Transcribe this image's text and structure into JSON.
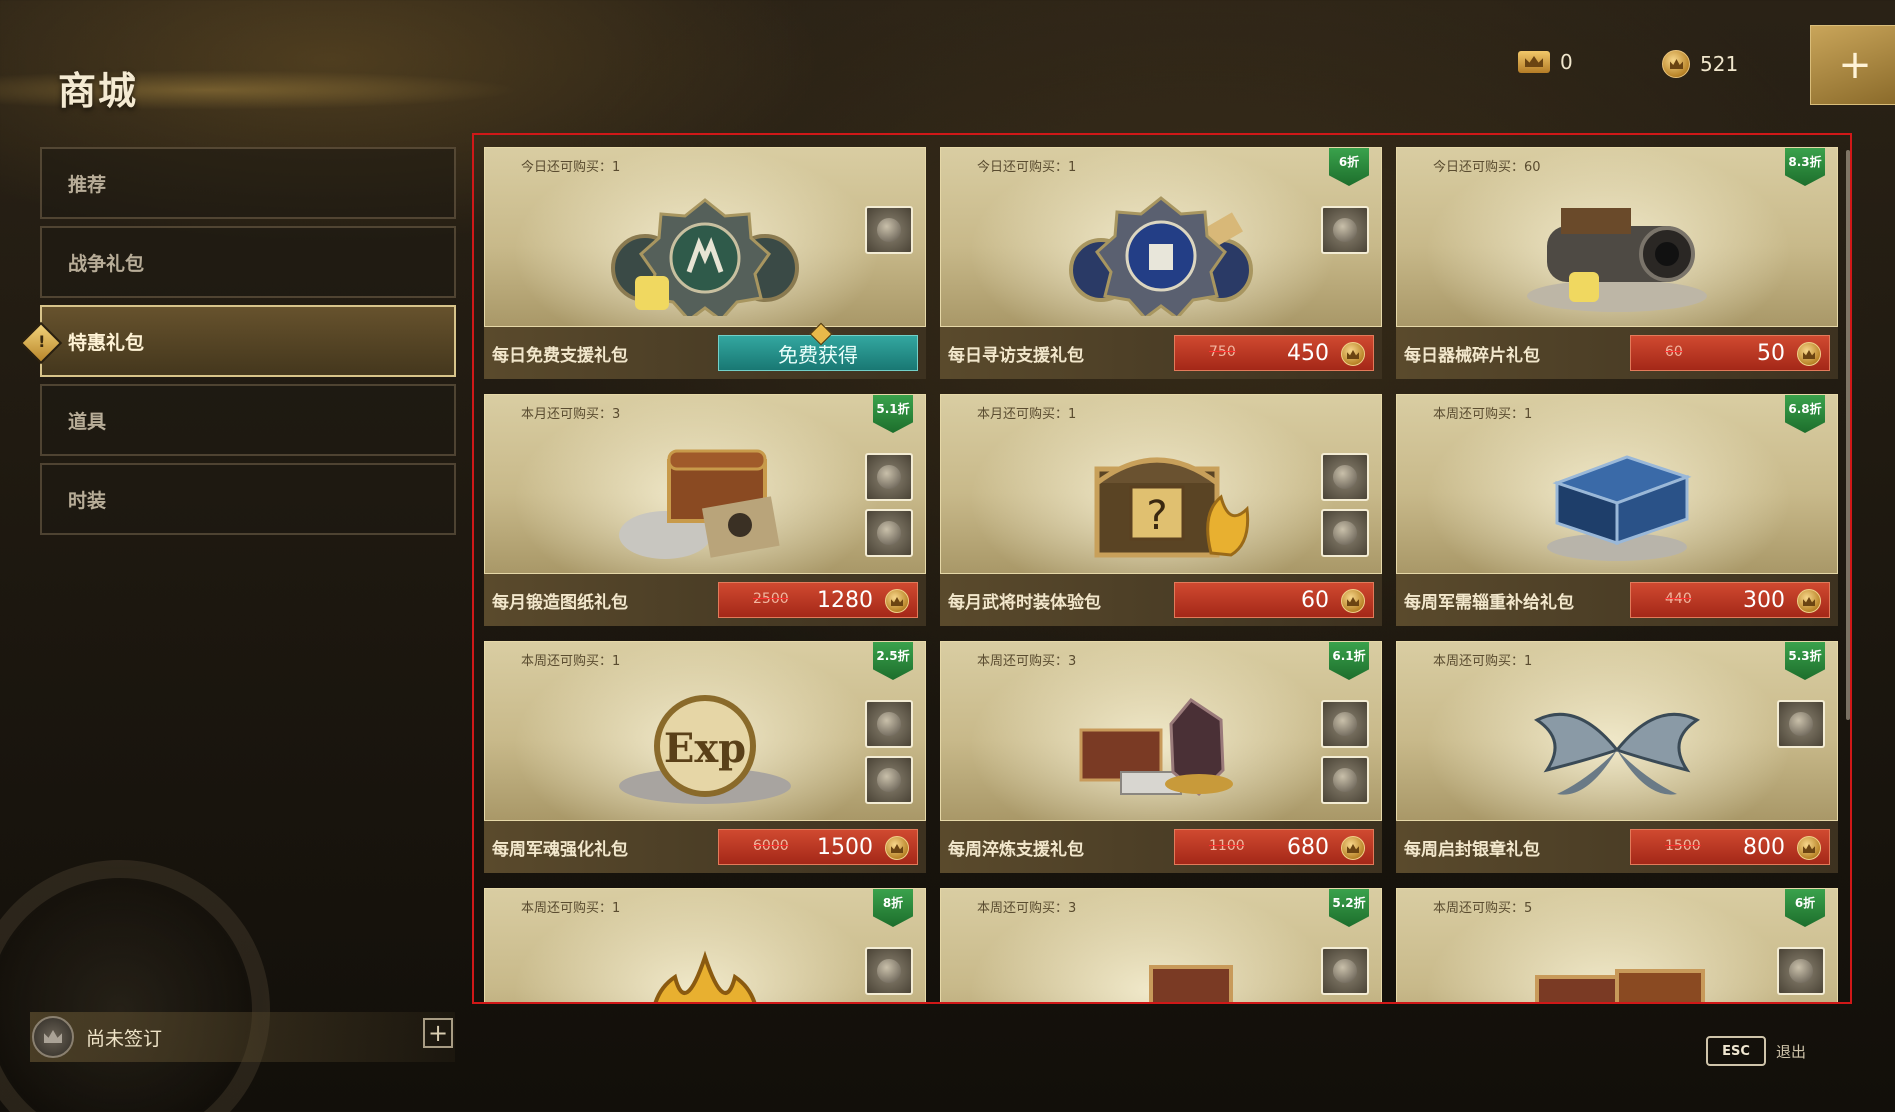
{
  "header": {
    "title": "商城",
    "currencies": [
      {
        "icon": "crown-gold-icon",
        "value": "0"
      },
      {
        "icon": "gold-coin-icon",
        "value": "521"
      }
    ],
    "add_label": "+"
  },
  "sidebar": {
    "items": [
      {
        "label": "推荐"
      },
      {
        "label": "战争礼包"
      },
      {
        "label": "特惠礼包",
        "active": true
      },
      {
        "label": "道具"
      },
      {
        "label": "时装"
      }
    ],
    "active_marker": "!"
  },
  "footer": {
    "sign_status": "尚未签订",
    "sign_add": "+",
    "esc_key": "ESC",
    "esc_label": "退出"
  },
  "colors": {
    "accent_gold": "#d8c48a",
    "price_red": "#c43a24",
    "free_teal": "#2a9590",
    "discount_green": "#2c8a3c",
    "highlight_frame": "#d01818"
  },
  "packs": [
    {
      "limit": "今日还可购买：1",
      "discount": "",
      "name": "每日免费支援礼包",
      "free_label": "免费获得",
      "price_old": "",
      "price_new": "",
      "hero": "emblem-green",
      "thumbs": [
        "emblem-thumb"
      ]
    },
    {
      "limit": "今日还可购买：1",
      "discount": "6折",
      "name": "每日寻访支援礼包",
      "price_old": "750",
      "price_new": "450",
      "hero": "emblem-blue",
      "thumbs": [
        "emblem-blue-thumb"
      ]
    },
    {
      "limit": "今日还可购买：60",
      "discount": "8.3折",
      "name": "每日器械碎片礼包",
      "price_old": "60",
      "price_new": "50",
      "hero": "cannon",
      "thumbs": []
    },
    {
      "limit": "本月还可购买：3",
      "discount": "5.1折",
      "name": "每月锻造图纸礼包",
      "price_old": "2500",
      "price_new": "1280",
      "hero": "chest-silver",
      "thumbs": [
        "chest-thumb",
        "ore-thumb"
      ]
    },
    {
      "limit": "本月还可购买：1",
      "discount": "",
      "name": "每月武将时装体验包",
      "price_old": "",
      "price_new": "60",
      "hero": "mystery-chest",
      "thumbs": [
        "mystery-thumb",
        "flame-thumb"
      ]
    },
    {
      "limit": "本周还可购买：1",
      "discount": "6.8折",
      "name": "每周军需辎重补给礼包",
      "price_old": "440",
      "price_new": "300",
      "hero": "blue-crate",
      "thumbs": []
    },
    {
      "limit": "本周还可购买：1",
      "discount": "2.5折",
      "name": "每周军魂强化礼包",
      "price_old": "6000",
      "price_new": "1500",
      "hero": "exp-badge",
      "thumbs": [
        "exp-thumb",
        "coins-chest-thumb"
      ]
    },
    {
      "limit": "本周还可购买：3",
      "discount": "6.1折",
      "name": "每周淬炼支援礼包",
      "price_old": "1100",
      "price_new": "680",
      "hero": "crystal-ingots",
      "thumbs": [
        "crystal-thumb",
        "chest-thumb"
      ]
    },
    {
      "limit": "本周还可购买：1",
      "discount": "5.3折",
      "name": "每周启封银章礼包",
      "price_old": "1500",
      "price_new": "800",
      "hero": "silver-wings",
      "thumbs": [
        "wings-thumb"
      ]
    },
    {
      "limit": "本周还可购买：1",
      "discount": "8折",
      "name": "",
      "price_old": "",
      "price_new": "",
      "hero": "gold-flame",
      "thumbs": [
        "flame-thumb"
      ]
    },
    {
      "limit": "本周还可购买：3",
      "discount": "5.2折",
      "name": "",
      "price_old": "",
      "price_new": "",
      "hero": "chest-ore",
      "thumbs": [
        "ore-thumb"
      ]
    },
    {
      "limit": "本周还可购买：5",
      "discount": "6折",
      "name": "",
      "price_old": "",
      "price_new": "",
      "hero": "chests",
      "thumbs": [
        "scroll-thumb"
      ]
    }
  ]
}
